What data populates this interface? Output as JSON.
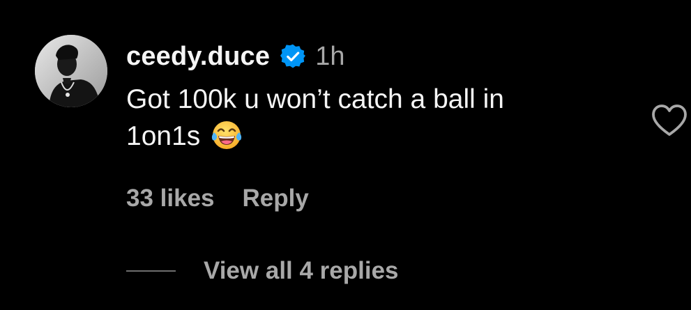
{
  "comment": {
    "username": "ceedy.duce",
    "verified": true,
    "verified_icon": "verified-badge-icon",
    "timestamp": "1h",
    "text_line1": "Got 100k u won’t catch a ball in",
    "text_line2": "1on1s",
    "emoji": "face-with-tears-of-joy",
    "likes": "33 likes",
    "reply_label": "Reply",
    "view_replies": "View all 4 replies",
    "like_icon": "heart-outline-icon"
  },
  "colors": {
    "background": "#000000",
    "primary_text": "#f5f5f5",
    "secondary_text": "#a8a8a8",
    "verified_blue": "#0095f6"
  }
}
